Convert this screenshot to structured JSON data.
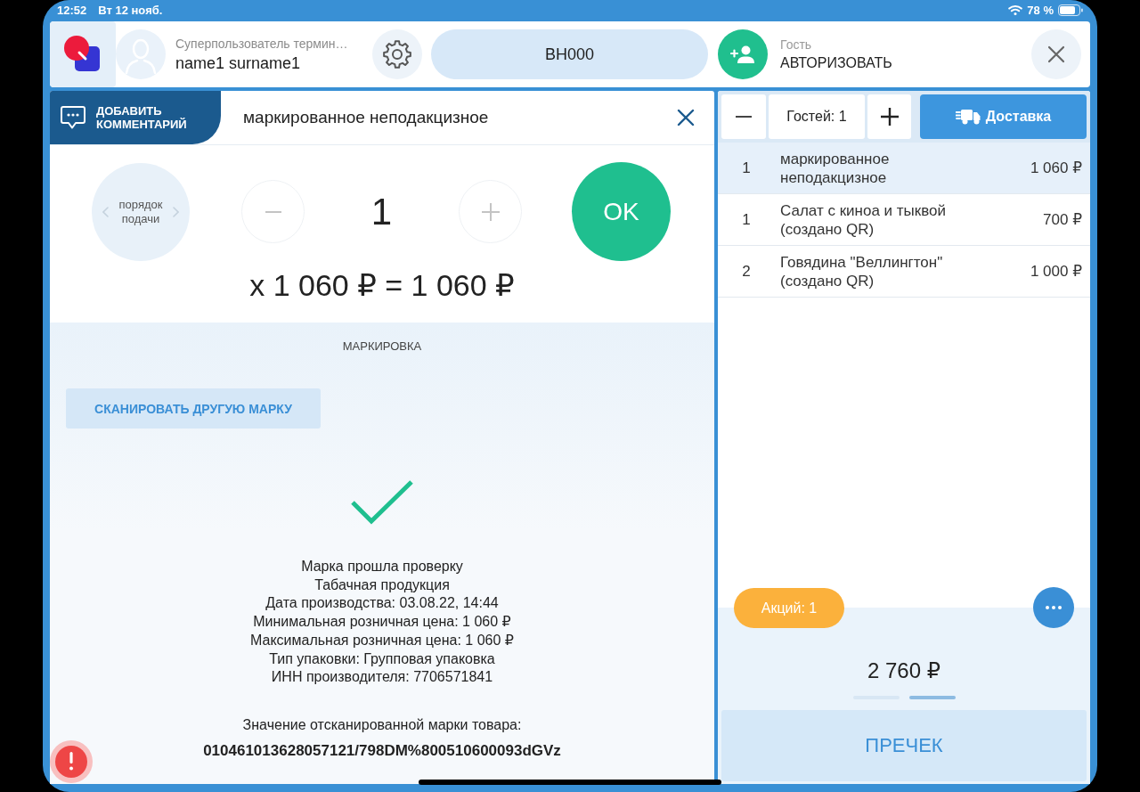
{
  "status_bar": {
    "time": "12:52",
    "date": "Вт 12 нояб.",
    "battery": "78 %"
  },
  "header": {
    "user_role": "Суперпользователь термин…",
    "user_name": "name1 surname1",
    "table": "ВН000",
    "guest_label": "Гость",
    "guest_action": "АВТОРИЗОВАТЬ"
  },
  "item_editor": {
    "comment_button": "ДОБАВИТЬ КОММЕНТАРИЙ",
    "title": "маркированное неподакцизное",
    "course_button": "порядок подачи",
    "quantity": "1",
    "ok_button": "OK",
    "formula": "x 1 060 ₽ = 1 060 ₽"
  },
  "marking": {
    "heading": "МАРКИРОВКА",
    "scan_button": "СКАНИРОВАТЬ ДРУГУЮ МАРКУ",
    "verified": true,
    "details": [
      "Марка прошла проверку",
      "Табачная продукция",
      "Дата производства: 03.08.22, 14:44",
      "Минимальная розничная цена: 1 060 ₽",
      "Максимальная розничная цена: 1 060 ₽",
      "Тип упаковки: Групповая упаковка",
      "ИНН производителя: 7706571841"
    ],
    "code_label": "Значение отсканированной марки товара:",
    "code": "010461013628057121/798DM%800510600093dGVz"
  },
  "order_panel": {
    "guests": "Гостей: 1",
    "delivery_button": "Доставка",
    "rows": [
      {
        "quantity": "1",
        "name": "маркированное неподакцизное",
        "price": "1 060 ₽",
        "selected": true
      },
      {
        "quantity": "1",
        "name": "Салат с киноа и тыквой (создано QR)",
        "price": "700 ₽",
        "selected": false
      },
      {
        "quantity": "2",
        "name": "Говядина \"Веллингтон\" (создано QR)",
        "price": "1 000 ₽",
        "selected": false
      }
    ],
    "promotions": "Акций: 1",
    "total": "2 760 ₽",
    "pages": [
      {
        "selected": false
      },
      {
        "selected": true
      }
    ],
    "precheck_button": "ПРЕЧЕК"
  }
}
